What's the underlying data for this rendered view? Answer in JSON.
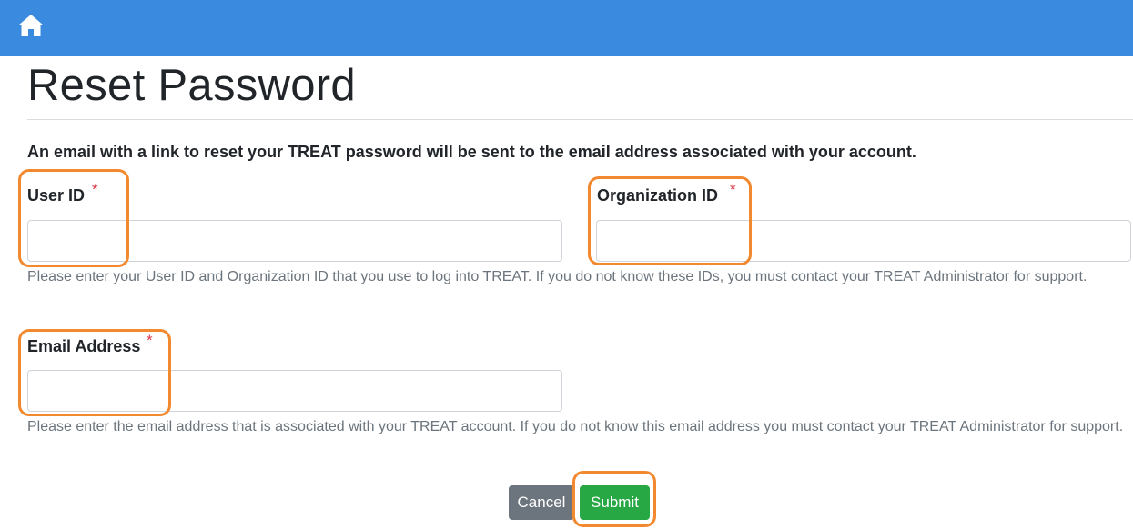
{
  "navbar": {
    "home_icon": "home-icon",
    "color": "#3a8be0"
  },
  "page": {
    "title": "Reset Password",
    "intro": "An email with a link to reset your TREAT password will be sent to the email address associated with your account."
  },
  "form": {
    "required_marker": "*",
    "user_id": {
      "label": "User ID",
      "value": "",
      "placeholder": ""
    },
    "organization_id": {
      "label": "Organization ID",
      "value": "",
      "placeholder": ""
    },
    "ids_help": "Please enter your User ID and Organization ID that you use to log into TREAT. If you do not know these IDs, you must contact your TREAT Administrator for support.",
    "email": {
      "label": "Email Address",
      "value": "",
      "placeholder": ""
    },
    "email_help": "Please enter the email address that is associated with your TREAT account. If you do not know this email address you must contact your TREAT Administrator for support."
  },
  "actions": {
    "cancel_label": "Cancel",
    "submit_label": "Submit"
  },
  "colors": {
    "highlight": "#f3892f",
    "required": "#dc3545",
    "submit": "#28a745",
    "cancel": "#6c757d"
  }
}
